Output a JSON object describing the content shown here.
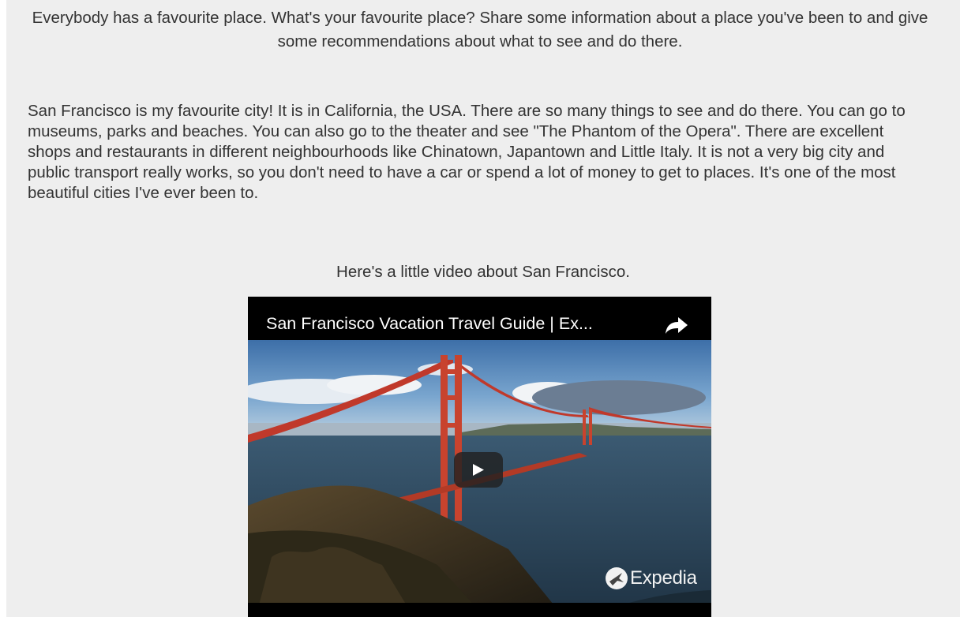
{
  "intro_text": "Everybody has a favourite place. What's your favourite place? Share some information about a place you've been to and give some recommendations about what to see and do there.",
  "story_text": "San Francisco is my favourite city! It is in California, the USA. There are so many things to see and do there. You can go to museums, parks and beaches. You can also go to the theater and see \"The Phantom of the Opera\". There are excellent shops and restaurants in different neighbourhoods like Chinatown, Japantown and Little Italy. It is not a very big city and public transport really works, so you don't need to have a car or spend a lot of money to get to places. It's one of the most beautiful cities I've ever been to.",
  "video_caption": "Here's a little video about San Francisco.",
  "video": {
    "title": "San Francisco Vacation Travel Guide | Ex...",
    "share_icon": "share-arrow-icon",
    "play_icon": "play-icon",
    "watermark": "Expedia"
  },
  "colors": {
    "page_background": "#eeeeee",
    "text": "#333333",
    "bridge": "#c0392b"
  }
}
